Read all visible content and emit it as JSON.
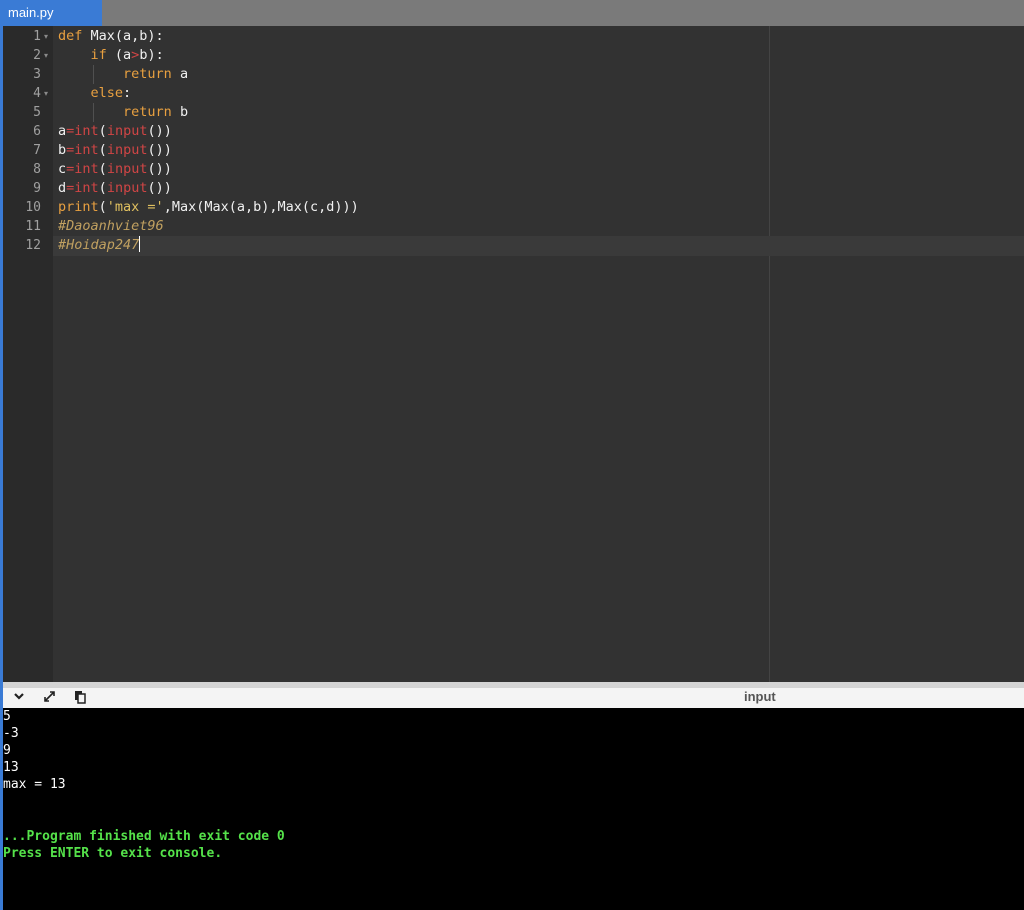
{
  "tab": {
    "label": "main.py"
  },
  "editor": {
    "lines": [
      {
        "num": "1",
        "fold": true,
        "tokens": [
          {
            "t": "def ",
            "c": "kw"
          },
          {
            "t": "Max(a,b):",
            "c": ""
          }
        ]
      },
      {
        "num": "2",
        "fold": true,
        "tokens": [
          {
            "t": "    ",
            "c": ""
          },
          {
            "t": "if ",
            "c": "kw"
          },
          {
            "t": "(a",
            "c": ""
          },
          {
            "t": ">",
            "c": "bi"
          },
          {
            "t": "b):",
            "c": ""
          }
        ]
      },
      {
        "num": "3",
        "fold": false,
        "tokens": [
          {
            "t": "        ",
            "c": ""
          },
          {
            "t": "return ",
            "c": "kw"
          },
          {
            "t": "a",
            "c": ""
          }
        ]
      },
      {
        "num": "4",
        "fold": true,
        "tokens": [
          {
            "t": "    ",
            "c": ""
          },
          {
            "t": "else",
            "c": "kw"
          },
          {
            "t": ":",
            "c": ""
          }
        ]
      },
      {
        "num": "5",
        "fold": false,
        "tokens": [
          {
            "t": "        ",
            "c": ""
          },
          {
            "t": "return ",
            "c": "kw"
          },
          {
            "t": "b",
            "c": ""
          }
        ]
      },
      {
        "num": "6",
        "fold": false,
        "tokens": [
          {
            "t": "a",
            "c": ""
          },
          {
            "t": "=",
            "c": "bi"
          },
          {
            "t": "int",
            "c": "bi"
          },
          {
            "t": "(",
            "c": ""
          },
          {
            "t": "input",
            "c": "bi"
          },
          {
            "t": "())",
            "c": ""
          }
        ]
      },
      {
        "num": "7",
        "fold": false,
        "tokens": [
          {
            "t": "b",
            "c": ""
          },
          {
            "t": "=",
            "c": "bi"
          },
          {
            "t": "int",
            "c": "bi"
          },
          {
            "t": "(",
            "c": ""
          },
          {
            "t": "input",
            "c": "bi"
          },
          {
            "t": "())",
            "c": ""
          }
        ]
      },
      {
        "num": "8",
        "fold": false,
        "tokens": [
          {
            "t": "c",
            "c": ""
          },
          {
            "t": "=",
            "c": "bi"
          },
          {
            "t": "int",
            "c": "bi"
          },
          {
            "t": "(",
            "c": ""
          },
          {
            "t": "input",
            "c": "bi"
          },
          {
            "t": "())",
            "c": ""
          }
        ]
      },
      {
        "num": "9",
        "fold": false,
        "tokens": [
          {
            "t": "d",
            "c": ""
          },
          {
            "t": "=",
            "c": "bi"
          },
          {
            "t": "int",
            "c": "bi"
          },
          {
            "t": "(",
            "c": ""
          },
          {
            "t": "input",
            "c": "bi"
          },
          {
            "t": "())",
            "c": ""
          }
        ]
      },
      {
        "num": "10",
        "fold": false,
        "tokens": [
          {
            "t": "print",
            "c": "kw"
          },
          {
            "t": "(",
            "c": ""
          },
          {
            "t": "'max ='",
            "c": "str"
          },
          {
            "t": ",Max(Max(a,b),Max(c,d)))",
            "c": ""
          }
        ]
      },
      {
        "num": "11",
        "fold": false,
        "tokens": [
          {
            "t": "#Daoanhviet96",
            "c": "cm"
          }
        ]
      },
      {
        "num": "12",
        "fold": false,
        "tokens": [
          {
            "t": "#Hoidap247",
            "c": "cm"
          }
        ]
      }
    ]
  },
  "console_toolbar": {
    "collapse_icon": "chevron-down-icon",
    "expand_icon": "expand-icon",
    "copy_icon": "copy-icon",
    "input_label": "input"
  },
  "console": {
    "output_lines": [
      "5",
      "-3",
      "9",
      "13",
      "max = 13"
    ],
    "status_lines": [
      "...Program finished with exit code 0",
      "Press ENTER to exit console."
    ]
  },
  "colors": {
    "tab_active": "#3a7bd5",
    "keyword": "#e8a040",
    "builtin": "#d04545",
    "string": "#e0c060",
    "status_green": "#55e24a"
  }
}
